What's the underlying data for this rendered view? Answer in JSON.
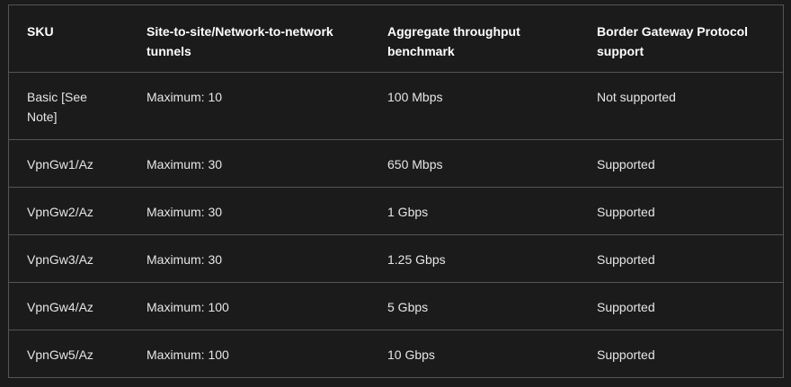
{
  "table": {
    "headers": [
      "SKU",
      "Site-to-site/Network-to-network tunnels",
      "Aggregate throughput benchmark",
      "Border Gateway Protocol support"
    ],
    "rows": [
      [
        "Basic [See Note]",
        "Maximum: 10",
        "100 Mbps",
        "Not supported"
      ],
      [
        "VpnGw1/Az",
        "Maximum: 30",
        "650 Mbps",
        "Supported"
      ],
      [
        "VpnGw2/Az",
        "Maximum: 30",
        "1 Gbps",
        "Supported"
      ],
      [
        "VpnGw3/Az",
        "Maximum: 30",
        "1.25 Gbps",
        "Supported"
      ],
      [
        "VpnGw4/Az",
        "Maximum: 100",
        "5 Gbps",
        "Supported"
      ],
      [
        "VpnGw5/Az",
        "Maximum: 100",
        "10 Gbps",
        "Supported"
      ]
    ]
  }
}
